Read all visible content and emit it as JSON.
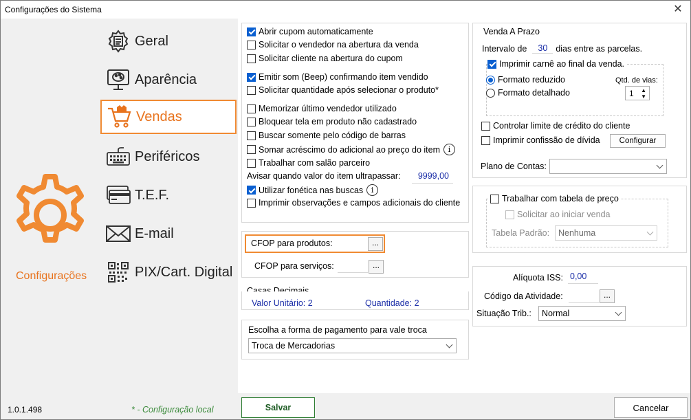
{
  "window": {
    "title": "Configurações do Sistema",
    "close_symbol": "✕"
  },
  "nav": {
    "items": [
      {
        "label": "Geral",
        "icon": "gear-document-icon"
      },
      {
        "label": "Aparência",
        "icon": "monitor-palette-icon"
      },
      {
        "label": "Vendas",
        "icon": "shopping-cart-icon",
        "active": true
      },
      {
        "label": "Periféricos",
        "icon": "keyboard-icon"
      },
      {
        "label": "T.E.F.",
        "icon": "card-icon"
      },
      {
        "label": "E-mail",
        "icon": "envelope-icon"
      },
      {
        "label": "PIX/Cart. Digital",
        "icon": "qr-code-icon"
      }
    ],
    "section_label": "Configurações"
  },
  "options": [
    {
      "label": "Abrir cupom automaticamente",
      "checked": true
    },
    {
      "label": "Solicitar o vendedor na abertura da venda",
      "checked": false
    },
    {
      "label": "Solicitar cliente na abertura do cupom",
      "checked": false
    },
    {
      "label": "Emitir som (Beep) confirmando item vendido",
      "checked": true
    },
    {
      "label": "Solicitar quantidade após selecionar o produto*",
      "checked": false
    },
    {
      "label": "Memorizar último vendedor utilizado",
      "checked": false
    },
    {
      "label": "Bloquear tela em produto não cadastrado",
      "checked": false
    },
    {
      "label": "Buscar somente pelo código de barras",
      "checked": false
    },
    {
      "label": "Somar acréscimo do adicional ao preço do item",
      "checked": false
    },
    {
      "label": "Trabalhar com salão parceiro",
      "checked": false
    },
    {
      "label": "Utilizar fonética nas buscas",
      "checked": true
    },
    {
      "label": "Imprimir observações e campos adicionais do cliente",
      "checked": false
    }
  ],
  "avisar": {
    "label": "Avisar quando valor do item ultrapassar:",
    "value": "9999,00"
  },
  "cfop": {
    "produtos_label": "CFOP para produtos:",
    "servicos_label": "CFOP para serviços:",
    "button": "..."
  },
  "casas": {
    "title": "Casas Decimais",
    "unit_label": "Valor Unitário:",
    "unit_value": "2",
    "qty_label": "Quantidade:",
    "qty_value": "2"
  },
  "vale_troca": {
    "title": "Escolha a forma de pagamento para vale troca",
    "selected": "Troca de Mercadorias"
  },
  "prazo": {
    "title": "Venda A Prazo",
    "intervalo_prefix": "Intervalo de",
    "intervalo_value": "30",
    "intervalo_suffix": "dias entre as parcelas.",
    "carne_label": "Imprimir carnê ao final da venda.",
    "formato_reduzido": "Formato reduzido",
    "formato_detalhado": "Formato detalhado",
    "qtd_vias_label": "Qtd. de vias:",
    "qtd_vias_value": "1",
    "limite_label": "Controlar limite de crédito do cliente",
    "confissao_label": "Imprimir confissão de dívida",
    "configurar_button": "Configurar",
    "plano_label": "Plano de Contas:",
    "plano_value": ""
  },
  "tabela": {
    "label": "Trabalhar com tabela de preço",
    "solicitar_label": "Solicitar ao iniciar venda",
    "padrao_label": "Tabela Padrão:",
    "padrao_value": "Nenhuma"
  },
  "iss": {
    "aliquota_label": "Alíquota ISS:",
    "aliquota_value": "0,00",
    "atividade_label": "Código da Atividade:",
    "situacao_label": "Situação Trib.:",
    "situacao_value": "Normal"
  },
  "footer": {
    "version": "1.0.1.498",
    "local_note": "* - Configuração local",
    "save": "Salvar",
    "cancel": "Cancelar"
  },
  "colors": {
    "accent": "#e8731d",
    "check_blue": "#0a5fd0",
    "value_blue": "#1c2fa8",
    "save_green": "#2e7d32"
  }
}
